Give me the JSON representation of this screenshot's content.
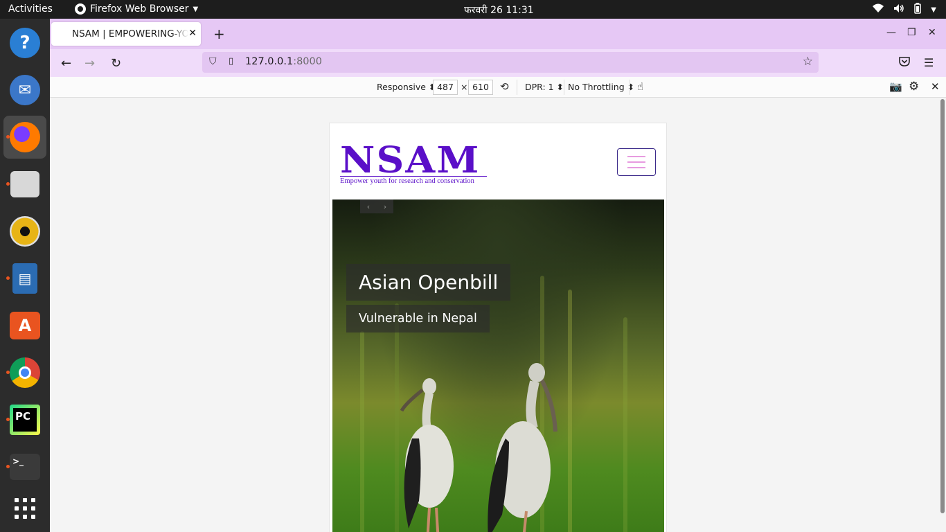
{
  "topbar": {
    "activities": "Activities",
    "app_name": "Firefox Web Browser",
    "clock": "फरवरी 26  11:31"
  },
  "dock": {
    "items": [
      {
        "name": "help",
        "glyph": "?",
        "color": "#2a7fd4"
      },
      {
        "name": "thunderbird",
        "glyph": "✉",
        "color": "#3b77c9"
      },
      {
        "name": "firefox",
        "glyph": "●",
        "color": "#e66000"
      },
      {
        "name": "files",
        "glyph": "▭",
        "color": "#c9c9c9"
      },
      {
        "name": "rhythmbox",
        "glyph": "◉",
        "color": "#e7b416"
      },
      {
        "name": "writer",
        "glyph": "▤",
        "color": "#2b6cb3"
      },
      {
        "name": "software",
        "glyph": "A",
        "color": "#e95420"
      },
      {
        "name": "chrome",
        "glyph": "◎",
        "color": "#4285f4"
      },
      {
        "name": "pycharm",
        "glyph": "PC",
        "color": "#1a1a1a"
      },
      {
        "name": "terminal",
        "glyph": ">_",
        "color": "#3a3a3a"
      }
    ],
    "apps_grid": "⋮⋮⋮"
  },
  "browser": {
    "tab_title": "NSAM | EMPOWERING-YOUTH",
    "url_host": "127.0.0.1",
    "url_port": ":8000"
  },
  "rdm": {
    "device": "Responsive ⬍",
    "width": "487",
    "times": "×",
    "height": "610",
    "dpr": "DPR: 1 ⬍",
    "throttling": "No Throttling ⬍"
  },
  "site": {
    "logo_text": "NSAM",
    "tagline": "Empower youth for research and conservation",
    "caption_title": "Asian Openbill",
    "caption_subtitle": "Vulnerable in Nepal",
    "prev": "‹",
    "next": "›"
  },
  "colors": {
    "tab_bar": "#e6c8f5",
    "nav_bar": "#f0dcfa",
    "logo": "#5a0fc8"
  }
}
